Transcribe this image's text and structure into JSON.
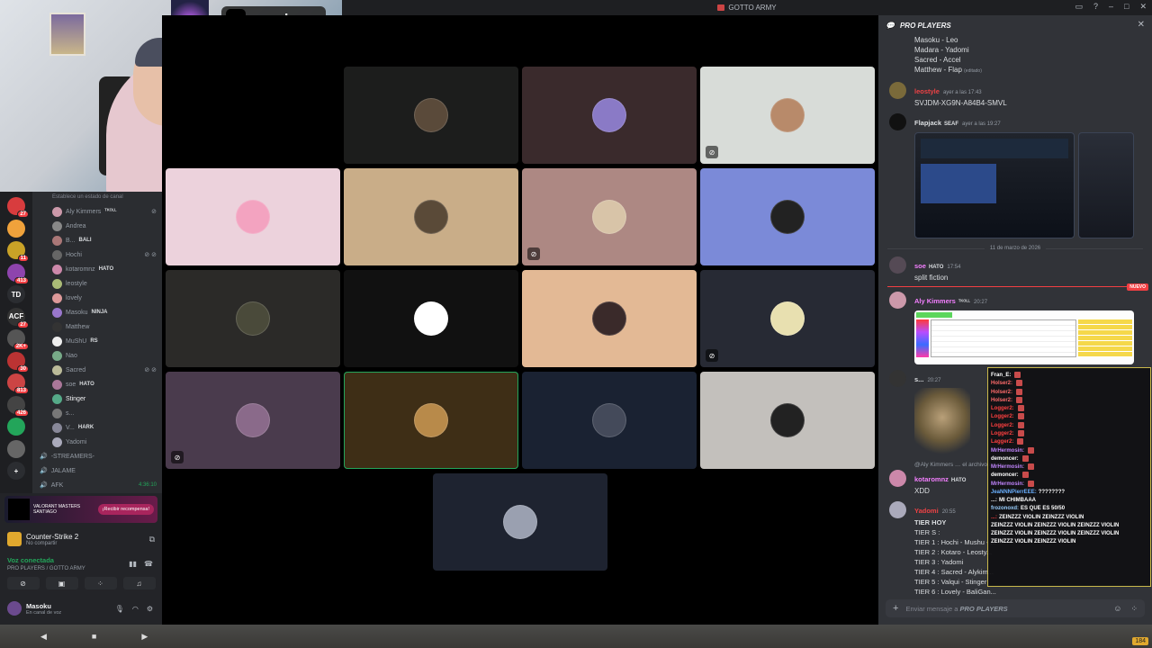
{
  "window": {
    "title": "GOTTO ARMY"
  },
  "tiktok": {
    "handle": "masokugg"
  },
  "rail": {
    "items": [
      {
        "label": "",
        "badge": "27",
        "color": "#d83c3e"
      },
      {
        "label": "",
        "badge": "",
        "color": "#f0a23b"
      },
      {
        "label": "",
        "badge": "11",
        "color": "#c9a227"
      },
      {
        "label": "",
        "badge": "413",
        "color": "#8e44ad"
      },
      {
        "label": "TD",
        "badge": "",
        "color": "#2b2d31"
      },
      {
        "label": "ACF",
        "badge": "27",
        "color": "#333"
      },
      {
        "label": "",
        "badge": "2K+",
        "color": "#555"
      },
      {
        "label": "",
        "badge": "30",
        "color": "#b33"
      },
      {
        "label": "",
        "badge": "813",
        "color": "#c44"
      },
      {
        "label": "",
        "badge": "426",
        "color": "#444"
      },
      {
        "label": "",
        "badge": "",
        "color": "#23a55a"
      },
      {
        "label": "",
        "badge": "",
        "color": "#666"
      },
      {
        "label": "+",
        "badge": "",
        "color": "#2b2d31"
      }
    ]
  },
  "channels": {
    "status_hint": "Establece un estado de canal",
    "users": [
      {
        "name": "Aly Kimmers",
        "tag": "ᵀᴷᴼᴸᴸ",
        "mic": "muted",
        "color": "#c9a"
      },
      {
        "name": "Andrea",
        "tag": "",
        "mic": "",
        "color": "#888"
      },
      {
        "name": "B...",
        "tag": "BALI",
        "mic": "",
        "color": "#a77"
      },
      {
        "name": "Hochi",
        "tag": "",
        "mic": "muted deaf",
        "color": "#666"
      },
      {
        "name": "kotaromnz",
        "tag": "HATO",
        "mic": "",
        "color": "#c8a"
      },
      {
        "name": "leostyle",
        "tag": "",
        "mic": "",
        "color": "#ab7"
      },
      {
        "name": "lovely",
        "tag": "",
        "mic": "",
        "color": "#d99"
      },
      {
        "name": "Masoku",
        "tag": "NINJA",
        "mic": "",
        "color": "#97c"
      },
      {
        "name": "Matthew",
        "tag": "",
        "mic": "",
        "color": "#333"
      },
      {
        "name": "MuShU",
        "tag": "RS",
        "mic": "",
        "color": "#eee"
      },
      {
        "name": "Nao",
        "tag": "",
        "mic": "",
        "color": "#7a8"
      },
      {
        "name": "Sacred",
        "tag": "",
        "mic": "muted deaf",
        "color": "#bb9"
      },
      {
        "name": "soe",
        "tag": "HATO",
        "mic": "",
        "color": "#a79"
      },
      {
        "name": "Stinger",
        "tag": "",
        "mic": "",
        "color": "#5a8"
      },
      {
        "name": "s...",
        "tag": "",
        "mic": "",
        "color": "#777"
      },
      {
        "name": "V...",
        "tag": "HARK",
        "mic": "",
        "color": "#889"
      },
      {
        "name": "Yadomi",
        "tag": "",
        "mic": "",
        "color": "#aab"
      }
    ],
    "voice_channels": [
      {
        "name": "-STREAMERS-",
        "time": ""
      },
      {
        "name": "JALAME",
        "time": ""
      },
      {
        "name": "AFK",
        "time": "4:36:10"
      }
    ]
  },
  "promo": {
    "brand": "VALORANT MASTERS SANTIAGO",
    "button": "¡Recibir recompensa!"
  },
  "game": {
    "name": "Counter-Strike 2",
    "sub": "No compartir"
  },
  "voice": {
    "status": "Voz conectada",
    "location": "PRO PLAYERS / GOTTO ARMY"
  },
  "me": {
    "name": "Masoku",
    "sub": "En canal de voz"
  },
  "tiles": [
    {
      "bg": "#1c1d1c",
      "avatar": "#5a4a3a",
      "muted": false,
      "speaking": false
    },
    {
      "bg": "#3a2a2c",
      "avatar": "#8a7ac6",
      "muted": false,
      "speaking": false
    },
    {
      "bg": "#d8dcd8",
      "avatar": "#b88a6a",
      "muted": true,
      "speaking": false
    },
    {
      "bg": "#ecd2dc",
      "avatar": "#f3a3c0",
      "muted": false,
      "speaking": false
    },
    {
      "bg": "#c9ad88",
      "avatar": "#5a4a38",
      "muted": false,
      "speaking": false
    },
    {
      "bg": "#ad8883",
      "avatar": "#d8c4a8",
      "muted": true,
      "speaking": false
    },
    {
      "bg": "#7b8ad8",
      "avatar": "#222",
      "muted": false,
      "speaking": false
    },
    {
      "bg": "#2b2a28",
      "avatar": "#4a4a3a",
      "muted": false,
      "speaking": false
    },
    {
      "bg": "#111111",
      "avatar": "#ffffff",
      "muted": false,
      "speaking": false
    },
    {
      "bg": "#e3b995",
      "avatar": "#3a2a2a",
      "muted": false,
      "speaking": false
    },
    {
      "bg": "#272a34",
      "avatar": "#e8e0b0",
      "muted": true,
      "speaking": false
    },
    {
      "bg": "#4a3b4d",
      "avatar": "#8a6a8a",
      "muted": true,
      "speaking": false
    },
    {
      "bg": "#3e2e16",
      "avatar": "#b88a4a",
      "muted": false,
      "speaking": true
    },
    {
      "bg": "#1a2232",
      "avatar": "#444a5a",
      "muted": false,
      "speaking": false
    },
    {
      "bg": "#c3c0bc",
      "avatar": "#222",
      "muted": false,
      "speaking": false
    },
    {
      "bg": "#1e2330",
      "avatar": "#9aa0b0",
      "muted": false,
      "speaking": false
    }
  ],
  "chat": {
    "channel": "PRO PLAYERS",
    "top_lines": [
      "Masoku - Leo",
      "Madara - Yadomi",
      "Sacred - Accel",
      "Matthew - Flap"
    ],
    "edited": "(editado)",
    "m1": {
      "author": "leostyle",
      "time": "ayer a las 17:43",
      "text": "SVJDM-XG9N-A84B4-SMVL",
      "color": "#ed4245"
    },
    "m2": {
      "author": "Flapjack",
      "tag": "SEAF",
      "time": "ayer a las 19:27",
      "color": "#dbdee1"
    },
    "date_sep": "11 de marzo de 2026",
    "m3": {
      "author": "soe",
      "tag": "HATO",
      "time": "17:54",
      "text": "split fiction",
      "color": "#f47fff"
    },
    "new_label": "NUEVO",
    "m4": {
      "author": "Aly Kimmers",
      "tag": "ᵀᴷᴼᴸᴸ",
      "time": "20:27",
      "color": "#f47fff"
    },
    "m5": {
      "author": "s...",
      "time": "20:27"
    },
    "reply_prefix": "@Aly Kimmers",
    "reply_tail": "el archivo adjunto",
    "m6": {
      "author": "kotaromnz",
      "tag": "HATO",
      "text": "XDD",
      "color": "#f47fff"
    },
    "m7": {
      "author": "Yadomi",
      "time": "20:55",
      "color": "#ed4245"
    },
    "tiers": [
      "TIER HOY",
      "TIER S :",
      "TIER 1 : Hochi - Mushu - ...",
      "TIER 2 : Kotaro - Leosty...",
      "TIER 3 : Yadomi",
      "TIER 4 : Sacred - Alykim...",
      "TIER 5 : Valqui - Stinger",
      "TIER 6 : Lovely - BaliGan..."
    ],
    "composer_prefix": "Enviar mensaje a",
    "composer_channel": "PRO PLAYERS"
  },
  "twitch": [
    {
      "user": "Fran_E:",
      "msg": "",
      "color": "#ffffff"
    },
    {
      "user": "Holser2:",
      "msg": "",
      "color": "#ff6b6b"
    },
    {
      "user": "Holser2:",
      "msg": "",
      "color": "#ff6b6b"
    },
    {
      "user": "Holser2:",
      "msg": "",
      "color": "#ff6b6b"
    },
    {
      "user": "Logger2:",
      "msg": "",
      "color": "#ff4040"
    },
    {
      "user": "Logger2:",
      "msg": "",
      "color": "#ff4040"
    },
    {
      "user": "Logger2:",
      "msg": "",
      "color": "#ff4040"
    },
    {
      "user": "Logger2:",
      "msg": "",
      "color": "#ff4040"
    },
    {
      "user": "Lagger2:",
      "msg": "",
      "color": "#ff4040"
    },
    {
      "user": "MrHermosin:",
      "msg": "",
      "color": "#c084fc"
    },
    {
      "user": "demoncer:",
      "msg": "",
      "color": "#ffffff"
    },
    {
      "user": "MrHermosin:",
      "msg": "",
      "color": "#c084fc"
    },
    {
      "user": "demoncer:",
      "msg": "",
      "color": "#ffffff"
    },
    {
      "user": "MrHermosin:",
      "msg": "",
      "color": "#c084fc"
    },
    {
      "user": "JeaNNNPierrEEE:",
      "msg": "????????",
      "color": "#6ab0ff"
    },
    {
      "user": "...:",
      "msg": "MI CHIMBAAA",
      "color": "#ffffff"
    },
    {
      "user": "frozonoxd:",
      "msg": "ES QUE ES 50/50",
      "color": "#9ad0ff"
    },
    {
      "user": "...:",
      "msg": "ZEINZZZ VIOLIN  ZEINZZZ VIOLIN",
      "color": "#ff4040"
    },
    {
      "user": "",
      "msg": "ZEINZZZ VIOLIN  ZEINZZZ VIOLIN  ZEINZZZ VIOLIN",
      "color": "#ffffff"
    },
    {
      "user": "",
      "msg": "ZEINZZZ VIOLIN  ZEINZZZ VIOLIN  ZEINZZZ VIOLIN",
      "color": "#ffffff"
    },
    {
      "user": "",
      "msg": "ZEINZZZ VIOLIN  ZEINZZZ VIOLIN",
      "color": "#ffffff"
    }
  ],
  "taskbar": {
    "tray_count": "184"
  }
}
